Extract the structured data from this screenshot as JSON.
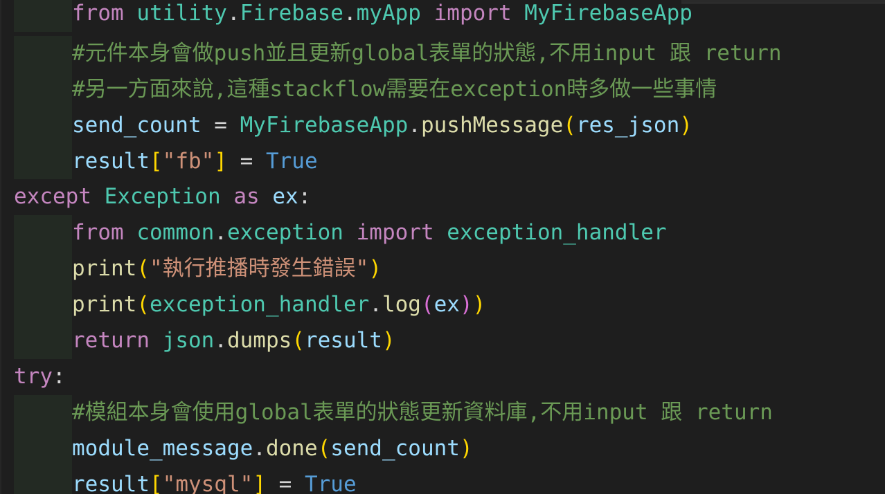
{
  "editor": {
    "lines": [
      {
        "indent": true,
        "tokens": [
          {
            "t": "from",
            "c": "kw-pink"
          },
          {
            "t": " ",
            "c": "pun"
          },
          {
            "t": "utility",
            "c": "mod"
          },
          {
            "t": ".",
            "c": "pun"
          },
          {
            "t": "Firebase",
            "c": "mod"
          },
          {
            "t": ".",
            "c": "pun"
          },
          {
            "t": "myApp",
            "c": "mod"
          },
          {
            "t": " ",
            "c": "pun"
          },
          {
            "t": "import",
            "c": "kw-pink"
          },
          {
            "t": " ",
            "c": "pun"
          },
          {
            "t": "MyFirebaseApp",
            "c": "mod"
          }
        ]
      },
      {
        "indent": true,
        "tokens": [
          {
            "t": "#元件本身會做push並且更新global表單的狀態,不用input 跟 return",
            "c": "cmt"
          }
        ]
      },
      {
        "indent": true,
        "tokens": [
          {
            "t": "#另一方面來說,這種stackflow需要在exception時多做一些事情",
            "c": "cmt"
          }
        ]
      },
      {
        "indent": true,
        "tokens": [
          {
            "t": "send_count",
            "c": "var"
          },
          {
            "t": " = ",
            "c": "pun"
          },
          {
            "t": "MyFirebaseApp",
            "c": "mod"
          },
          {
            "t": ".",
            "c": "pun"
          },
          {
            "t": "pushMessage",
            "c": "fn"
          },
          {
            "t": "(",
            "c": "br1"
          },
          {
            "t": "res_json",
            "c": "var"
          },
          {
            "t": ")",
            "c": "br1"
          }
        ]
      },
      {
        "indent": true,
        "tokens": [
          {
            "t": "result",
            "c": "var"
          },
          {
            "t": "[",
            "c": "br1"
          },
          {
            "t": "\"fb\"",
            "c": "str"
          },
          {
            "t": "]",
            "c": "br1"
          },
          {
            "t": " = ",
            "c": "pun"
          },
          {
            "t": "True",
            "c": "kw-blue"
          }
        ]
      },
      {
        "indent": false,
        "tokens": [
          {
            "t": "except",
            "c": "kw-pink"
          },
          {
            "t": " ",
            "c": "pun"
          },
          {
            "t": "Exception",
            "c": "mod"
          },
          {
            "t": " ",
            "c": "pun"
          },
          {
            "t": "as",
            "c": "kw-pink"
          },
          {
            "t": " ",
            "c": "pun"
          },
          {
            "t": "ex",
            "c": "var"
          },
          {
            "t": ":",
            "c": "pun"
          }
        ]
      },
      {
        "indent": true,
        "tokens": [
          {
            "t": "from",
            "c": "kw-pink"
          },
          {
            "t": " ",
            "c": "pun"
          },
          {
            "t": "common",
            "c": "mod"
          },
          {
            "t": ".",
            "c": "pun"
          },
          {
            "t": "exception",
            "c": "mod"
          },
          {
            "t": " ",
            "c": "pun"
          },
          {
            "t": "import",
            "c": "kw-pink"
          },
          {
            "t": " ",
            "c": "pun"
          },
          {
            "t": "exception_handler",
            "c": "mod"
          }
        ]
      },
      {
        "indent": true,
        "tokens": [
          {
            "t": "print",
            "c": "fn"
          },
          {
            "t": "(",
            "c": "br1"
          },
          {
            "t": "\"執行推播時發生錯誤\"",
            "c": "str"
          },
          {
            "t": ")",
            "c": "br1"
          }
        ]
      },
      {
        "indent": true,
        "tokens": [
          {
            "t": "print",
            "c": "fn"
          },
          {
            "t": "(",
            "c": "br1"
          },
          {
            "t": "exception_handler",
            "c": "mod"
          },
          {
            "t": ".",
            "c": "pun"
          },
          {
            "t": "log",
            "c": "fn"
          },
          {
            "t": "(",
            "c": "br2"
          },
          {
            "t": "ex",
            "c": "var"
          },
          {
            "t": ")",
            "c": "br2"
          },
          {
            "t": ")",
            "c": "br1"
          }
        ]
      },
      {
        "indent": true,
        "tokens": [
          {
            "t": "return",
            "c": "kw-pink"
          },
          {
            "t": " ",
            "c": "pun"
          },
          {
            "t": "json",
            "c": "mod"
          },
          {
            "t": ".",
            "c": "pun"
          },
          {
            "t": "dumps",
            "c": "fn"
          },
          {
            "t": "(",
            "c": "br1"
          },
          {
            "t": "result",
            "c": "var"
          },
          {
            "t": ")",
            "c": "br1"
          }
        ]
      },
      {
        "indent": false,
        "tokens": [
          {
            "t": "try",
            "c": "kw-pink"
          },
          {
            "t": ":",
            "c": "pun"
          }
        ]
      },
      {
        "indent": true,
        "tokens": [
          {
            "t": "#模組本身會使用global表單的狀態更新資料庫,不用input 跟 return",
            "c": "cmt"
          }
        ]
      },
      {
        "indent": true,
        "tokens": [
          {
            "t": "module_message",
            "c": "var"
          },
          {
            "t": ".",
            "c": "pun"
          },
          {
            "t": "done",
            "c": "fn"
          },
          {
            "t": "(",
            "c": "br1"
          },
          {
            "t": "send_count",
            "c": "var"
          },
          {
            "t": ")",
            "c": "br1"
          }
        ]
      },
      {
        "indent": true,
        "tokens": [
          {
            "t": "result",
            "c": "var"
          },
          {
            "t": "[",
            "c": "br1"
          },
          {
            "t": "\"mysql\"",
            "c": "str"
          },
          {
            "t": "]",
            "c": "br1"
          },
          {
            "t": " = ",
            "c": "pun"
          },
          {
            "t": "True",
            "c": "kw-blue"
          }
        ]
      }
    ]
  }
}
